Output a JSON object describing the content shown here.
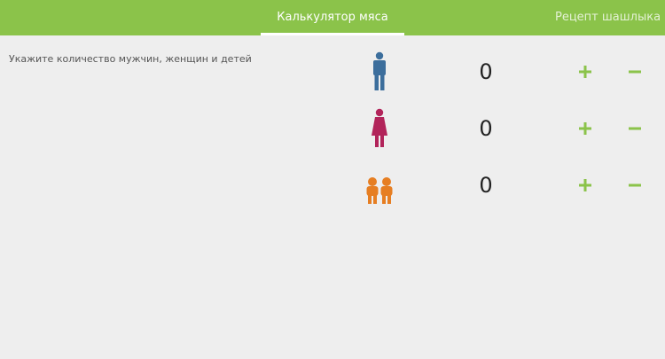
{
  "tabs": [
    {
      "label": "Калькулятор мяса"
    },
    {
      "label": "Рецепт шашлыка"
    }
  ],
  "instruction": "Укажите количество мужчин, женщин и детей",
  "rows": [
    {
      "icon": "man-icon",
      "color": "#3c6e9c",
      "count": "0"
    },
    {
      "icon": "woman-icon",
      "color": "#b2245a",
      "count": "0"
    },
    {
      "icon": "children-icon",
      "color": "#e67e22",
      "count": "0"
    }
  ],
  "accent_color": "#8bc34a"
}
